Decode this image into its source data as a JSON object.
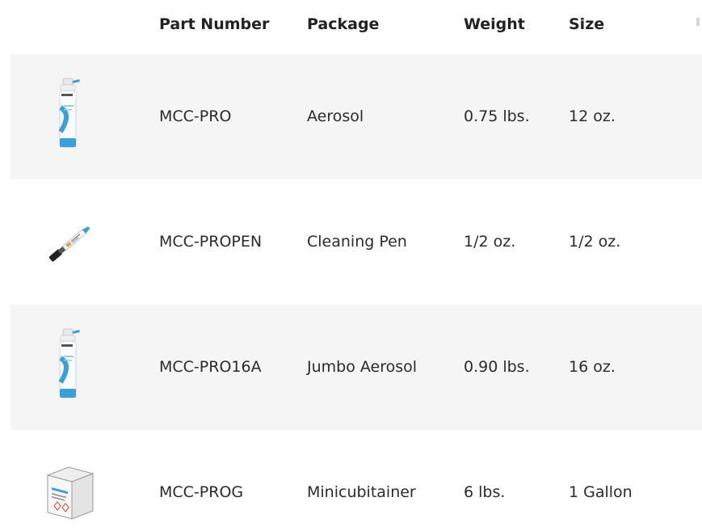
{
  "table": {
    "headers": {
      "image": "",
      "part_number": "Part Number",
      "package": "Package",
      "weight": "Weight",
      "size": "Size"
    },
    "rows": [
      {
        "image_icon": "aerosol-can-icon",
        "part_number": "MCC-PRO",
        "package": "Aerosol",
        "weight": "0.75 lbs.",
        "size": "12 oz."
      },
      {
        "image_icon": "cleaning-pen-icon",
        "part_number": "MCC-PROPEN",
        "package": "Cleaning Pen",
        "weight": "1/2 oz.",
        "size": "1/2 oz."
      },
      {
        "image_icon": "aerosol-can-icon",
        "part_number": "MCC-PRO16A",
        "package": "Jumbo Aerosol",
        "weight": "0.90 lbs.",
        "size": "16 oz."
      },
      {
        "image_icon": "minicubitainer-box-icon",
        "part_number": "MCC-PROG",
        "package": "Minicubitainer",
        "weight": "6 lbs.",
        "size": "1 Gallon"
      }
    ]
  },
  "colors": {
    "row_shade": "#f5f5f5",
    "text": "#2b2b2b",
    "can_blue": "#3b9fd8"
  }
}
